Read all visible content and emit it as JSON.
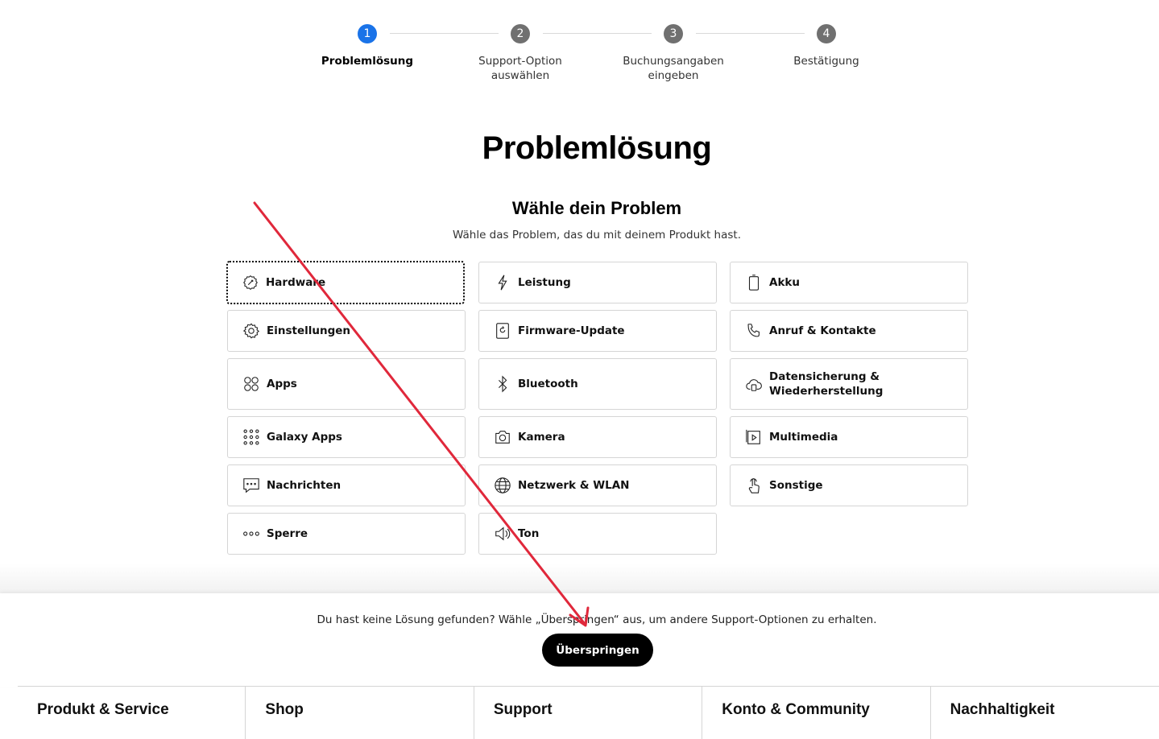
{
  "stepper": {
    "steps": [
      {
        "number": "1",
        "label": "Problemlösung",
        "active": true
      },
      {
        "number": "2",
        "label": "Support-Option auswählen",
        "active": false
      },
      {
        "number": "3",
        "label": "Buchungsangaben eingeben",
        "active": false
      },
      {
        "number": "4",
        "label": "Bestätigung",
        "active": false
      }
    ]
  },
  "page_title": "Problemlösung",
  "section": {
    "title": "Wähle dein Problem",
    "subtitle": "Wähle das Problem, das du mit deinem Produkt hast."
  },
  "problems": [
    {
      "label": "Hardware",
      "icon": "hardware-icon"
    },
    {
      "label": "Leistung",
      "icon": "lightning-icon"
    },
    {
      "label": "Akku",
      "icon": "battery-icon"
    },
    {
      "label": "Einstellungen",
      "icon": "gear-icon"
    },
    {
      "label": "Firmware-Update",
      "icon": "firmware-update-icon"
    },
    {
      "label": "Anruf & Kontakte",
      "icon": "phone-icon"
    },
    {
      "label": "Apps",
      "icon": "apps-icon"
    },
    {
      "label": "Bluetooth",
      "icon": "bluetooth-icon"
    },
    {
      "label": "Datensicherung & Wiederherstellung",
      "icon": "cloud-backup-icon"
    },
    {
      "label": "Galaxy Apps",
      "icon": "galaxy-apps-icon"
    },
    {
      "label": "Kamera",
      "icon": "camera-icon"
    },
    {
      "label": "Multimedia",
      "icon": "multimedia-icon"
    },
    {
      "label": "Nachrichten",
      "icon": "message-icon"
    },
    {
      "label": "Netzwerk & WLAN",
      "icon": "globe-icon"
    },
    {
      "label": "Sonstige",
      "icon": "touch-icon"
    },
    {
      "label": "Sperre",
      "icon": "lock-dots-icon"
    },
    {
      "label": "Ton",
      "icon": "speaker-icon"
    }
  ],
  "bottom": {
    "text": "Du hast keine Lösung gefunden? Wähle „Überspringen“ aus, um andere Support-Optionen zu erhalten.",
    "skip_label": "Überspringen"
  },
  "footer": {
    "columns": [
      "Produkt & Service",
      "Shop",
      "Support",
      "Konto & Community",
      "Nachhaltigkeit"
    ]
  },
  "colors": {
    "active_step": "#1a73e8",
    "inactive_step": "#707070",
    "annotation_arrow": "#e0283b"
  }
}
